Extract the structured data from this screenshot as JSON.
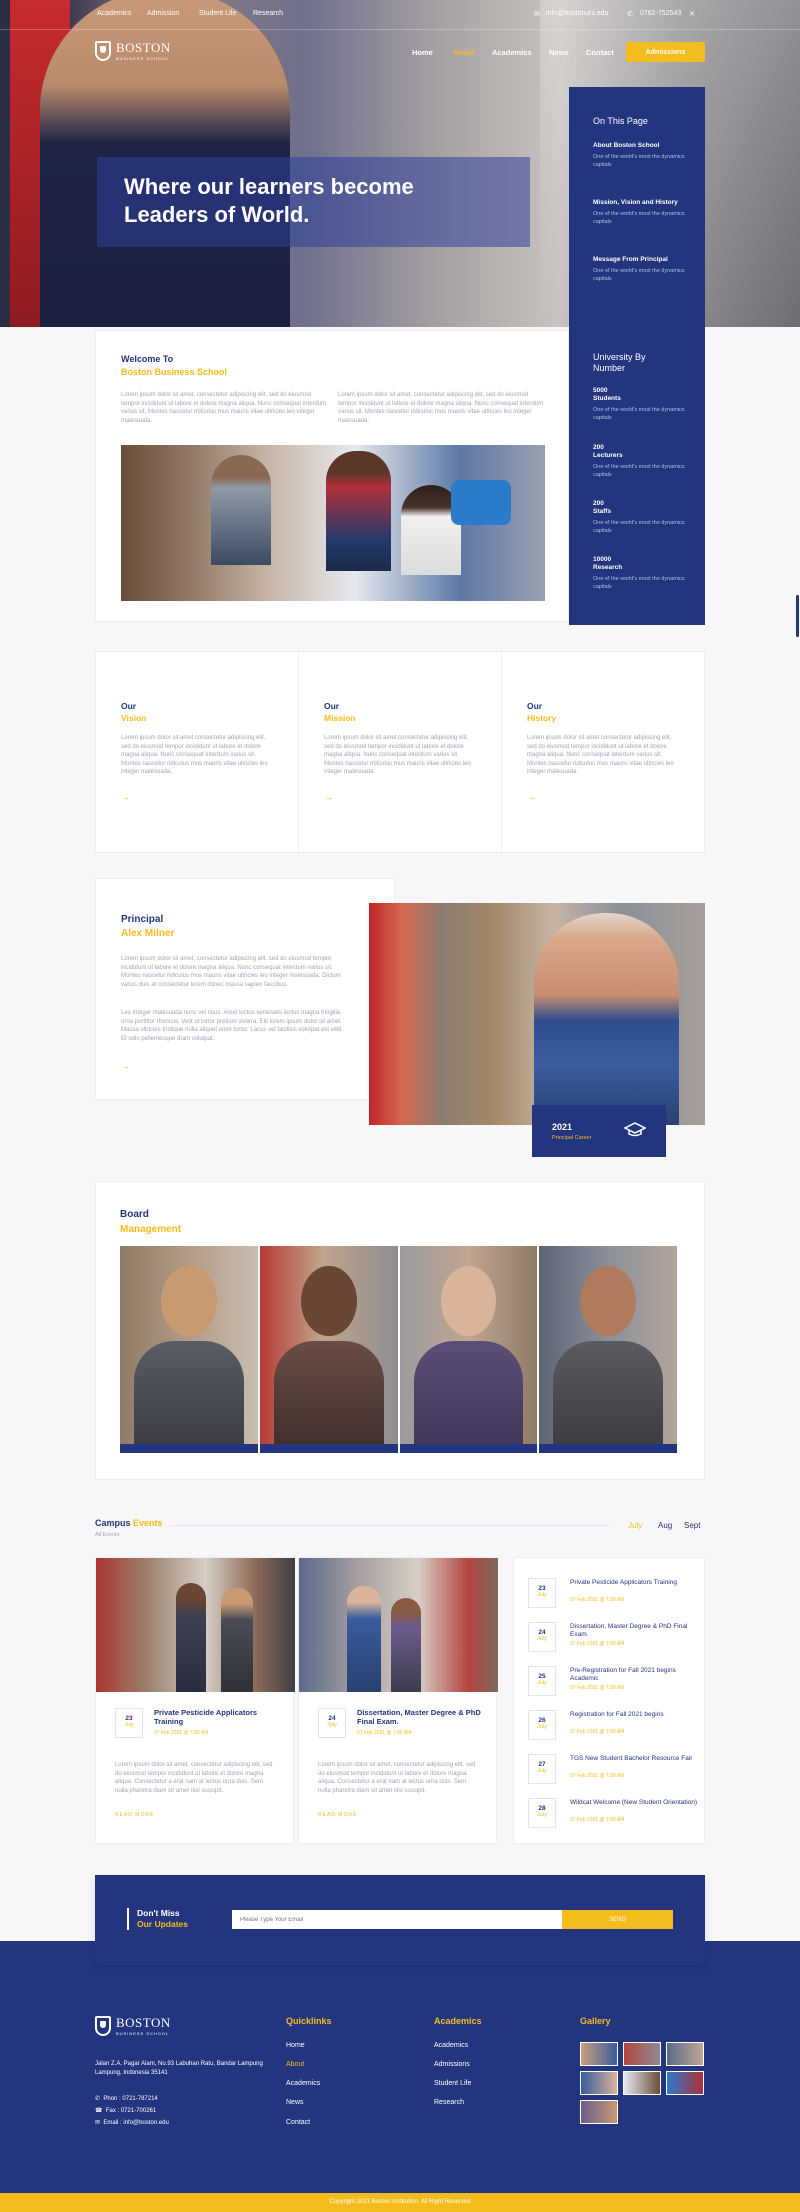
{
  "topbar": {
    "links": [
      "Academics",
      "Admission",
      "Student Life",
      "Research"
    ],
    "email": "info@bostonuni.edu",
    "phone": "0762-752543"
  },
  "brand": {
    "name": "BOSTON",
    "sub": "BUSINESS SCHOOL"
  },
  "nav": {
    "items": [
      "Home",
      "About",
      "Academics",
      "News",
      "Contact"
    ],
    "active": "About",
    "cta": "Admissions"
  },
  "hero": {
    "title": "Where our learners become Leaders of World."
  },
  "sidebar": {
    "title": "On This Page",
    "links": [
      {
        "title": "About Boston School",
        "desc": "One of the world's most the dynamics capitals"
      },
      {
        "title": "Mission, Vision and History",
        "desc": "One of the world's most the dynamics capitals"
      },
      {
        "title": "Message From Principal",
        "desc": "One of the world's most the dynamics capitals"
      }
    ],
    "stats_title": "University By Number",
    "stats": [
      {
        "num": "5000",
        "label": "Students",
        "desc": "One of the world's most the dynamics capitals"
      },
      {
        "num": "200",
        "label": "Lecturers",
        "desc": "One of the world's most the dynamics capitals"
      },
      {
        "num": "200",
        "label": "Staffs",
        "desc": "One of the world's most the dynamics capitals"
      },
      {
        "num": "10000",
        "label": "Research",
        "desc": "One of the world's most the dynamics capitals"
      }
    ]
  },
  "welcome": {
    "line1": "Welcome To",
    "line2": "Boston Business School",
    "p1": "Lorem ipsum dolor sit amet, consectetur adipiscing elit, sed do eiusmod tempor incididunt ut labore et dolore magna aliqua. Nunc consequat interdum varius sit. Montes nascetur ridiculus mus mauris vitae ultricies leo integer malesuada.",
    "p2": "Lorem ipsum dolor sit amet, consectetur adipiscing elit, sed do eiusmod tempor incididunt ut labore et dolore magna aliqua. Nunc consequat interdum varius sit. Montes nascetur ridiculus mus mauris vitae ultricies leo integer malesuada."
  },
  "vmh": [
    {
      "a": "Our",
      "b": "Vision",
      "p": "Lorem ipsum dolor sit amet consectetur adipiscing elit, sed do eiusmod tempor incididunt ut labore et dolore magna aliqua. Nunc consequat interdum varius sit. Montes nascetur ridiculus mus mauris vitae ultricies leo integer malesuada."
    },
    {
      "a": "Our",
      "b": "Mission",
      "p": "Lorem ipsum dolor sit amet consectetur adipiscing elit, sed do eiusmod tempor incididunt ut labore et dolore magna aliqua. Nunc consequat interdum varius sit. Montes nascetur ridiculus mus mauris vitae ultricies leo integer malesuada."
    },
    {
      "a": "Our",
      "b": "History",
      "p": "Lorem ipsum dolor sit amet consectetur adipiscing elit, sed do eiusmod tempor incididunt ut labore et dolore magna aliqua. Nunc consequat interdum varius sit. Montes nascetur ridiculus mus mauris vitae ultricies leo integer malesuada."
    }
  ],
  "principal": {
    "a": "Principal",
    "b": "Alex Milner",
    "p1": "Lorem ipsum dolor sit amet, consectetur adipiscing elit, sed do eiusmod tempor incididunt ut labore et dolore magna aliqua. Nunc consequat interdum varius sit. Montes nascetur ridiculus mus mauris vitae ultricies leo integer malesuada. Dictum varius duis at consectetur lorem donec massa sapien faucibus.",
    "p2": "Leo integer malesuada nunc vel risus. Amet luctus venenatis lectus magna fringilla urna porttitor rhoncus. Velit ut tortor pretium viverra. Elit lorem ipsum dolor sit amet. Massa ultricies tristique nulla aliquet enim tortor. Lacus vel facilisis volutpat est velit. Et odio pellentesque diam volutpat.",
    "year": "2021",
    "role": "Principal Career"
  },
  "board": {
    "a": "Board",
    "b": "Management"
  },
  "events": {
    "a": "Campus",
    "b": "Events",
    "sub": "All Events",
    "months": [
      "July",
      "Aug",
      "Sept"
    ],
    "active": "July",
    "cards": [
      {
        "day": "23",
        "month": "July",
        "title": "Private Pesticide Applicators Training",
        "time": "07 Feb 2021 @ 7:00 AM",
        "p": "Lorem ipsum dolor sit amet, consectetur adipiscing elit, sed do eiusmod tempor incididunt ut labore et dolore magna aliqua. Consectetur a erat nam at lectus urna duis. Sem nulla pharetra diam sit amet nisl suscipit.",
        "more": "READ MORE"
      },
      {
        "day": "24",
        "month": "July",
        "title": "Dissertation, Master Degree & PhD Final Exam.",
        "time": "07 Feb 2021 @ 7:00 AM",
        "p": "Lorem ipsum dolor sit amet, consectetur adipiscing elit, sed do eiusmod tempor incididunt ut labore et dolore magna aliqua. Consectetur a erat nam at lectus urna duis. Sem nulla pharetra diam sit amet nisl suscipit.",
        "more": "READ MORE"
      }
    ],
    "list": [
      {
        "day": "23",
        "month": "July",
        "title": "Private Pesticide Applicators Training",
        "time": "07 Feb 2021 @ 7:00 AM"
      },
      {
        "day": "24",
        "month": "July",
        "title": "Dissertation, Master Degree & PhD Final Exam.",
        "time": "07 Feb 2021 @ 7:00 AM"
      },
      {
        "day": "25",
        "month": "July",
        "title": "Pre-Registration for Fall 2021 begins Academic",
        "time": "07 Feb 2021 @ 7:00 AM"
      },
      {
        "day": "26",
        "month": "July",
        "title": "Registration for Fall 2021 begins",
        "time": "07 Feb 2021 @ 7:00 AM"
      },
      {
        "day": "27",
        "month": "July",
        "title": "TGS New Student Bachelor Resource Fair",
        "time": "07 Feb 2021 @ 7:00 AM"
      },
      {
        "day": "28",
        "month": "July",
        "title": "Wildcat Welcome (New Student Orientation)",
        "time": "07 Feb 2021 @ 7:00 AM"
      }
    ]
  },
  "subscribe": {
    "a": "Don't Miss",
    "b": "Our Updates",
    "placeholder": "Please Type Your Email",
    "button": "SEND"
  },
  "footer": {
    "address": "Jalan Z.A. Pagar Alam, No.93 Labuhan Ratu, Bandar Lampung Lampung, Indonesia 35141",
    "phone": "Phon : 0721-787214",
    "fax": "Fax : 0721-700261",
    "email": "Email : info@boston.edu",
    "quick_title": "Quicklinks",
    "quick": [
      "Home",
      "About",
      "Academics",
      "News",
      "Contact"
    ],
    "quick_active": "About",
    "acad_title": "Academics",
    "acad": [
      "Academics",
      "Admissions",
      "Student Life",
      "Research"
    ],
    "gallery_title": "Gallery"
  },
  "copyright": "Copyright 2021 Boston Institution. All Right Reserved"
}
